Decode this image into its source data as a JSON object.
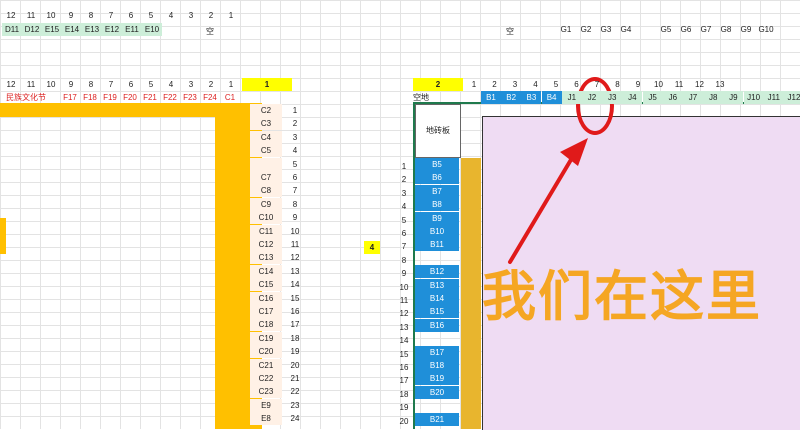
{
  "top_hdr_left": [
    "12",
    "11",
    "10",
    "9",
    "8",
    "7",
    "6",
    "5",
    "4",
    "3",
    "2",
    "1"
  ],
  "row2_left": [
    "D11",
    "D12",
    "E15",
    "E14",
    "E13",
    "E12",
    "E11",
    "E10"
  ],
  "row2_empty_label": "空",
  "row5_left": [
    "12",
    "11",
    "10",
    "9",
    "8",
    "7",
    "6",
    "5",
    "4",
    "3",
    "2",
    "1"
  ],
  "row6_left": [
    "民族文化节",
    "F17",
    "F18",
    "F19",
    "F20",
    "F21",
    "F22",
    "F23",
    "F24",
    "C1"
  ],
  "yellow_1": "1",
  "yellow_2": "2",
  "yellow_4": "4",
  "right_top_hdr": [
    "1",
    "2",
    "3",
    "4",
    "5",
    "6",
    "7",
    "8",
    "9",
    "10",
    "11",
    "12",
    "13"
  ],
  "right_row2_empty": "空",
  "right_row2_g": [
    "G1",
    "G2",
    "G3",
    "G4",
    "G5",
    "G6",
    "G7",
    "G8",
    "G9",
    "G10"
  ],
  "right_col_hdr": [
    "1",
    "2",
    "3",
    "4",
    "5",
    "6",
    "7",
    "8",
    "9",
    "10",
    "11",
    "12",
    "13",
    "14",
    "15",
    "16",
    "17",
    "18",
    "19",
    "20"
  ],
  "right_row6_label": "空地",
  "right_row6_cells": [
    "B1",
    "B2",
    "B3",
    "B4",
    "J1",
    "J2",
    "J3",
    "J4",
    "J5",
    "J6",
    "J7",
    "J8",
    "J9",
    "J10",
    "J11",
    "J12"
  ],
  "left_c_col": [
    "C2",
    "C3",
    "C4",
    "C5",
    "",
    "C7",
    "C8",
    "C9",
    "C10",
    "C11",
    "C12",
    "C13",
    "C14",
    "C15",
    "C16",
    "C17",
    "C18",
    "C19",
    "C20",
    "C21",
    "C22",
    "C23",
    "E9",
    "E8"
  ],
  "left_num_col": [
    "1",
    "2",
    "3",
    "4",
    "5",
    "6",
    "7",
    "8",
    "9",
    "10",
    "11",
    "12",
    "13",
    "14",
    "15",
    "16",
    "17",
    "18",
    "19",
    "20",
    "21",
    "22",
    "23",
    "24"
  ],
  "boxed_label": "地砖板",
  "b_col": [
    "B5",
    "B6",
    "B7",
    "B8",
    "B9",
    "B10",
    "B11",
    "",
    "B12",
    "B13",
    "B14",
    "B15",
    "B16",
    "",
    "B17",
    "B18",
    "B19",
    "B20",
    "",
    "B21"
  ],
  "annotation_text": "我们在这里",
  "colors": {
    "accent_yellow": "#ffc000",
    "highlight_yellow": "#ffff00",
    "cell_blue": "#1f8fd9",
    "frame_green": "#1f7a4d",
    "panel_lavender": "#efdcf3",
    "annotation_orange": "#f5a623",
    "annotation_red": "#e01a1a"
  }
}
